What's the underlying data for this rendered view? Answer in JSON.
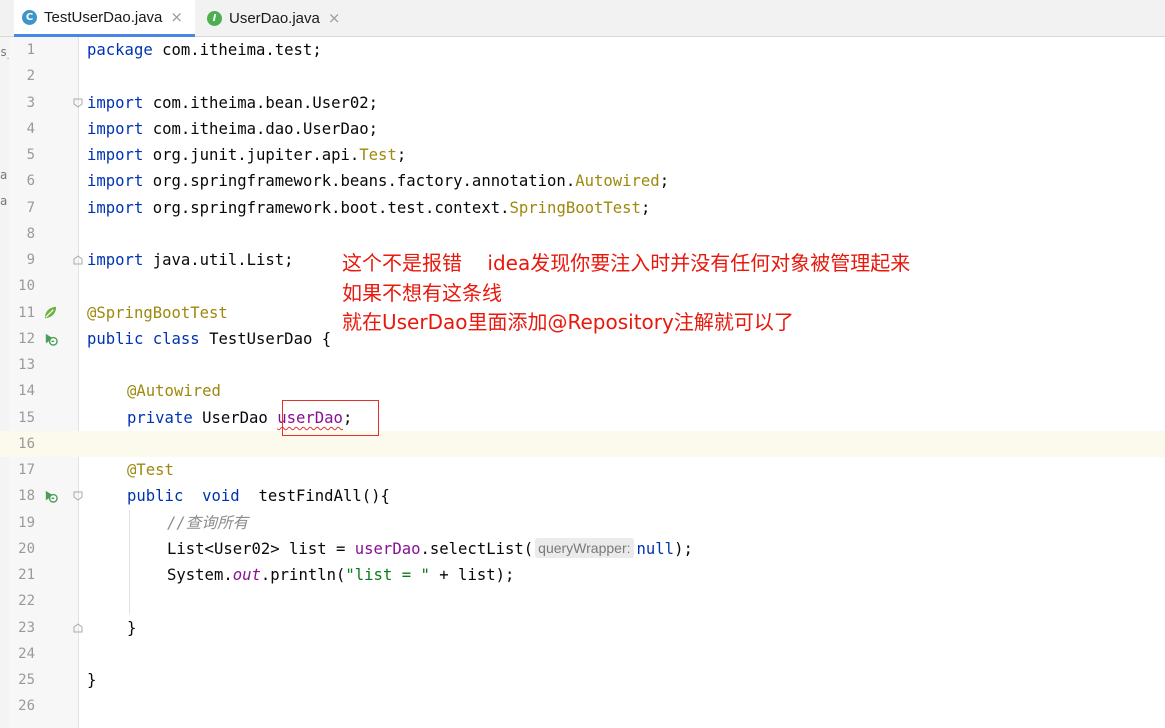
{
  "tabs": [
    {
      "label": "TestUserDao.java",
      "icon": "java-class-icon",
      "active": true
    },
    {
      "label": "UserDao.java",
      "icon": "java-interface-icon",
      "active": false
    }
  ],
  "left_strip_marks": [
    "s_",
    "a",
    "a"
  ],
  "code_lines": [
    {
      "n": "1"
    },
    {
      "n": "2"
    },
    {
      "n": "3"
    },
    {
      "n": "4"
    },
    {
      "n": "5"
    },
    {
      "n": "6"
    },
    {
      "n": "7"
    },
    {
      "n": "8"
    },
    {
      "n": "9"
    },
    {
      "n": "10"
    },
    {
      "n": "11"
    },
    {
      "n": "12"
    },
    {
      "n": "13"
    },
    {
      "n": "14"
    },
    {
      "n": "15"
    },
    {
      "n": "16"
    },
    {
      "n": "17"
    },
    {
      "n": "18"
    },
    {
      "n": "19"
    },
    {
      "n": "20"
    },
    {
      "n": "21"
    },
    {
      "n": "22"
    },
    {
      "n": "23"
    },
    {
      "n": "24"
    },
    {
      "n": "25"
    },
    {
      "n": "26"
    }
  ],
  "code": {
    "l1_kw": "package",
    "l1_rest": " com.itheima.test;",
    "l3_kw": "import",
    "l3_rest": " com.itheima.bean.User02;",
    "l4_kw": "import",
    "l4_rest": " com.itheima.dao.UserDao;",
    "l5_kw": "import",
    "l5_rest": " org.junit.jupiter.api.",
    "l5_cls": "Test",
    "l5_end": ";",
    "l6_kw": "import",
    "l6_rest": " org.springframework.beans.factory.annotation.",
    "l6_cls": "Autowired",
    "l6_end": ";",
    "l7_kw": "import",
    "l7_rest": " org.springframework.boot.test.context.",
    "l7_cls": "SpringBootTest",
    "l7_end": ";",
    "l9_kw": "import",
    "l9_rest": " java.util.List;",
    "l11_ann": "@SpringBootTest",
    "l12_kw1": "public",
    "l12_kw2": "class",
    "l12_rest": " TestUserDao {",
    "l14_ann": "@Autowired",
    "l15_kw": "private",
    "l15_type": " UserDao ",
    "l15_field": "userDao",
    "l15_end": ";",
    "l17_ann": "@Test",
    "l18_kw1": "public",
    "l18_kw2": "void",
    "l18_rest": "  testFindAll(){",
    "l19_cmt": "//查询所有",
    "l20_a": "List<User02> list = ",
    "l20_field": "userDao",
    "l20_b": ".selectList(",
    "l20_hint": "queryWrapper:",
    "l20_null": "null",
    "l20_c": ");",
    "l21_a": "System.",
    "l21_out": "out",
    "l21_b": ".println(",
    "l21_str": "\"list = \"",
    "l21_c": " + list);",
    "l23": "}",
    "l25": "}"
  },
  "annotation_note": {
    "line1": "这个不是报错    idea发现你要注入时并没有任何对象被管理起来",
    "line2": "如果不想有这条线",
    "line3": "就在UserDao里面添加@Repository注解就可以了"
  },
  "colors": {
    "keyword": "#0033b3",
    "annotation": "#9e880d",
    "field": "#871094",
    "comment": "#8c8c8c",
    "string": "#067d17",
    "note": "#e8180c"
  }
}
